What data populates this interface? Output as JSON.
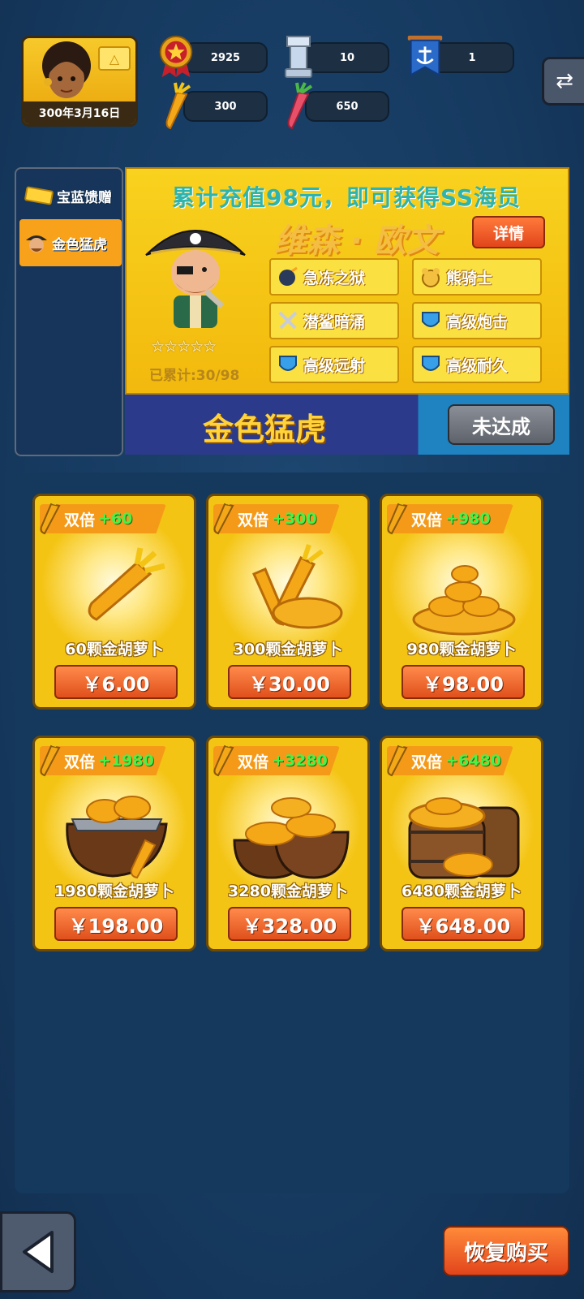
{
  "header": {
    "date": "300年3月16日",
    "stats": [
      {
        "icon": "star-medal-icon",
        "value": "2925"
      },
      {
        "icon": "tower-icon",
        "value": "10"
      },
      {
        "icon": "anchor-banner-icon",
        "value": "1"
      },
      {
        "icon": "gold-carrot-icon",
        "value": "300"
      },
      {
        "icon": "red-carrot-icon",
        "value": "650"
      }
    ],
    "swap_icon": "⇄"
  },
  "side_tabs": [
    {
      "label": "宝蓝馈赠",
      "icon": "ticket-icon",
      "active": false
    },
    {
      "label": "金色猛虎",
      "icon": "pirate-avatar-icon",
      "active": true
    }
  ],
  "promo": {
    "headline": "累计充值98元，即可获得SS海员",
    "character_name": "维森 · 欧文",
    "details_label": "详情",
    "stars": "☆☆☆☆☆",
    "progress": "已累计:30/98",
    "skills": [
      {
        "label": "急冻之狱",
        "icon": "bomb-icon"
      },
      {
        "label": "熊骑士",
        "icon": "bear-icon"
      },
      {
        "label": "潜鲨暗涌",
        "icon": "swords-icon"
      },
      {
        "label": "高级炮击",
        "icon": "shield-icon"
      },
      {
        "label": "高级远射",
        "icon": "shield-icon"
      },
      {
        "label": "高级耐久",
        "icon": "shield-icon"
      }
    ],
    "tier_title": "金色猛虎",
    "status_label": "未达成"
  },
  "store": {
    "items": [
      {
        "double": "双倍",
        "bonus": "+60",
        "label": "60颗金胡萝卜",
        "price": "￥6.00",
        "art": "single-carrot-icon"
      },
      {
        "double": "双倍",
        "bonus": "+300",
        "label": "300颗金胡萝卜",
        "price": "￥30.00",
        "art": "carrot-pair-icon"
      },
      {
        "double": "双倍",
        "bonus": "+980",
        "label": "980颗金胡萝卜",
        "price": "￥98.00",
        "art": "carrot-pile-icon"
      },
      {
        "double": "双倍",
        "bonus": "+1980",
        "label": "1980颗金胡萝卜",
        "price": "￥198.00",
        "art": "carrot-bag-icon"
      },
      {
        "double": "双倍",
        "bonus": "+3280",
        "label": "3280颗金胡萝卜",
        "price": "￥328.00",
        "art": "carrot-bags-icon"
      },
      {
        "double": "双倍",
        "bonus": "+6480",
        "label": "6480颗金胡萝卜",
        "price": "￥648.00",
        "art": "carrot-barrel-icon"
      }
    ]
  },
  "footer": {
    "back_icon": "back-arrow-icon",
    "restore_label": "恢复购买"
  },
  "colors": {
    "background": "#163a60",
    "gold": "#f4c414",
    "orange_button": "#e2451c",
    "bonus_green": "#4af04a",
    "headline_teal": "#2fb3ad"
  }
}
